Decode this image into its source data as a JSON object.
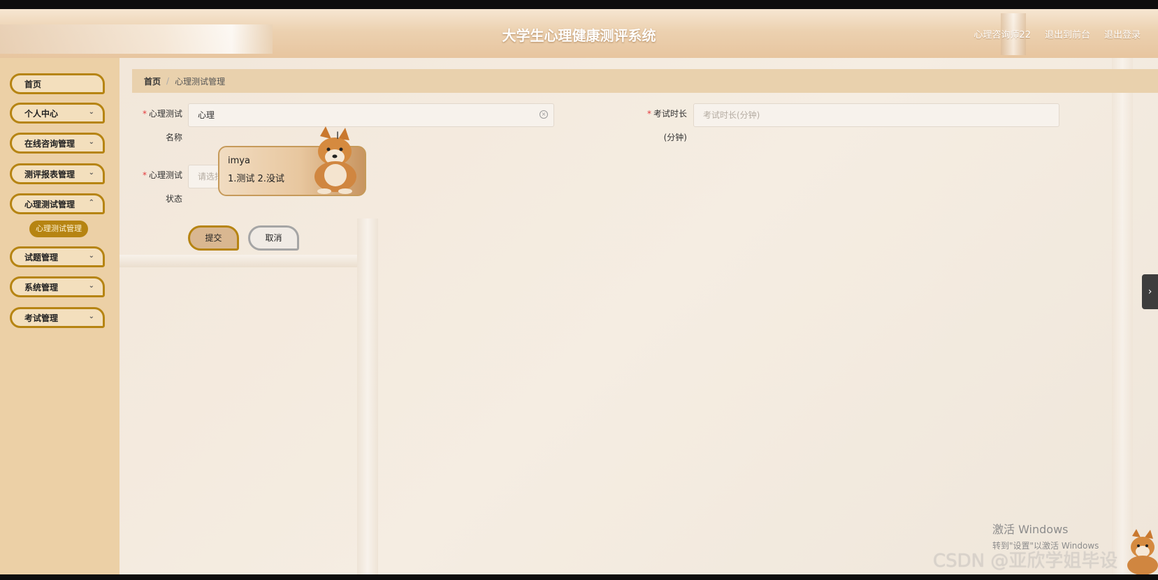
{
  "header": {
    "title": "大学生心理健康测评系统",
    "user": "心理咨询师22",
    "back_front": "退出到前台",
    "logout": "退出登录"
  },
  "sidebar": {
    "items": [
      {
        "label": "首页"
      },
      {
        "label": "个人中心"
      },
      {
        "label": "在线咨询管理"
      },
      {
        "label": "测评报表管理"
      },
      {
        "label": "心理测试管理"
      },
      {
        "label": "试题管理"
      },
      {
        "label": "系统管理"
      },
      {
        "label": "考试管理"
      }
    ],
    "active_sub": "心理测试管理"
  },
  "breadcrumb": {
    "home": "首页",
    "separator": "/",
    "current": "心理测试管理"
  },
  "form": {
    "name_label_1": "心理测试",
    "name_label_2": "名称",
    "name_value": "心理",
    "duration_label_1": "考试时长",
    "duration_label_2": "(分钟)",
    "duration_placeholder": "考试时长(分钟)",
    "status_label_1": "心理测试",
    "status_label_2": "状态",
    "status_placeholder": "请选择",
    "required_mark": "*",
    "submit": "提交",
    "cancel": "取消"
  },
  "ime": {
    "composition": "imya",
    "candidates": "1.测试  2.没试"
  },
  "watermarks": {
    "windows_1": "激活 Windows",
    "windows_2": "转到\"设置\"以激活 Windows",
    "csdn": "CSDN @亚欣学姐毕设"
  },
  "colors": {
    "accent": "#b68412",
    "sidebar_bg": "#ecd0a6",
    "breadcrumb_bg": "#e9d1ad",
    "required": "#e4393c"
  },
  "icons": {
    "clear": "circle-x-icon",
    "chevron": "chevron-down-icon",
    "toggle": "chevron-right-icon"
  }
}
